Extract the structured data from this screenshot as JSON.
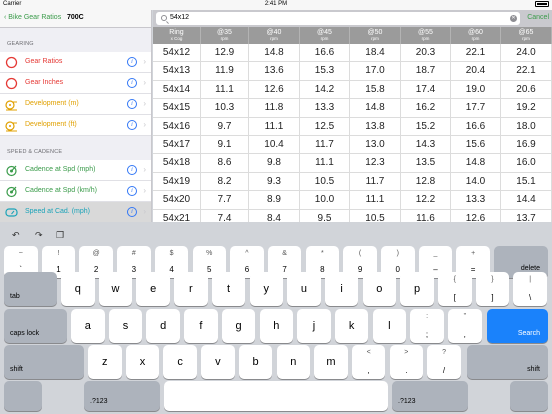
{
  "status": {
    "carrier": "Carrier",
    "time": "2:41 PM"
  },
  "sidebar": {
    "back_label": "Bike Gear Ratios",
    "wheel": "700C",
    "section1": "GEARING",
    "section2": "SPEED & CADENCE",
    "items": [
      {
        "label": "Gear Ratios",
        "color": "#e53935",
        "icon": "ring-icon"
      },
      {
        "label": "Gear Inches",
        "color": "#e53935",
        "icon": "ring-icon"
      },
      {
        "label": "Development (m)",
        "color": "#e0a000",
        "icon": "wheel-arrow-icon"
      },
      {
        "label": "Development (ft)",
        "color": "#e0a000",
        "icon": "wheel-arrow-icon"
      },
      {
        "label": "Cadence at Spd (mph)",
        "color": "#3a9b4a",
        "icon": "pedal-icon"
      },
      {
        "label": "Cadence at Spd (km/h)",
        "color": "#3a9b4a",
        "icon": "pedal-icon"
      },
      {
        "label": "Speed at Cad. (mph)",
        "color": "#1aa3b8",
        "icon": "speedometer-icon"
      }
    ]
  },
  "search": {
    "value": "54x12",
    "cancel": "Cancel"
  },
  "table": {
    "headers": [
      {
        "top": "Ring",
        "sub": "x Cog"
      },
      {
        "top": "@35",
        "sub": "rpm"
      },
      {
        "top": "@40",
        "sub": "rpm"
      },
      {
        "top": "@45",
        "sub": "rpm"
      },
      {
        "top": "@50",
        "sub": "rpm"
      },
      {
        "top": "@55",
        "sub": "rpm"
      },
      {
        "top": "@60",
        "sub": "rpm"
      },
      {
        "top": "@65",
        "sub": "rpm"
      }
    ],
    "rows": [
      [
        "54x12",
        "12.9",
        "14.8",
        "16.6",
        "18.4",
        "20.3",
        "22.1",
        "24.0"
      ],
      [
        "54x13",
        "11.9",
        "13.6",
        "15.3",
        "17.0",
        "18.7",
        "20.4",
        "22.1"
      ],
      [
        "54x14",
        "11.1",
        "12.6",
        "14.2",
        "15.8",
        "17.4",
        "19.0",
        "20.6"
      ],
      [
        "54x15",
        "10.3",
        "11.8",
        "13.3",
        "14.8",
        "16.2",
        "17.7",
        "19.2"
      ],
      [
        "54x16",
        "9.7",
        "11.1",
        "12.5",
        "13.8",
        "15.2",
        "16.6",
        "18.0"
      ],
      [
        "54x17",
        "9.1",
        "10.4",
        "11.7",
        "13.0",
        "14.3",
        "15.6",
        "16.9"
      ],
      [
        "54x18",
        "8.6",
        "9.8",
        "11.1",
        "12.3",
        "13.5",
        "14.8",
        "16.0"
      ],
      [
        "54x19",
        "8.2",
        "9.3",
        "10.5",
        "11.7",
        "12.8",
        "14.0",
        "15.1"
      ],
      [
        "54x20",
        "7.7",
        "8.9",
        "10.0",
        "11.1",
        "12.2",
        "13.3",
        "14.4"
      ],
      [
        "54x21",
        "7.4",
        "8.4",
        "9.5",
        "10.5",
        "11.6",
        "12.6",
        "13.7"
      ]
    ]
  },
  "keyboard": {
    "row1": [
      {
        "top": "~",
        "bot": "`"
      },
      {
        "top": "!",
        "bot": "1"
      },
      {
        "top": "@",
        "bot": "2"
      },
      {
        "top": "#",
        "bot": "3"
      },
      {
        "top": "$",
        "bot": "4"
      },
      {
        "top": "%",
        "bot": "5"
      },
      {
        "top": "^",
        "bot": "6"
      },
      {
        "top": "&",
        "bot": "7"
      },
      {
        "top": "*",
        "bot": "8"
      },
      {
        "top": "(",
        "bot": "9"
      },
      {
        "top": ")",
        "bot": "0"
      },
      {
        "top": "_",
        "bot": "–"
      },
      {
        "top": "+",
        "bot": "="
      }
    ],
    "delete": "delete",
    "tab": "tab",
    "row2": [
      "q",
      "w",
      "e",
      "r",
      "t",
      "y",
      "u",
      "i",
      "o",
      "p"
    ],
    "row2_extra": [
      {
        "top": "{",
        "bot": "["
      },
      {
        "top": "}",
        "bot": "]"
      },
      {
        "top": "|",
        "bot": "\\"
      }
    ],
    "caps": "caps lock",
    "row3": [
      "a",
      "s",
      "d",
      "f",
      "g",
      "h",
      "j",
      "k",
      "l"
    ],
    "row3_extra": [
      {
        "top": ":",
        "bot": ";"
      },
      {
        "top": "”",
        "bot": ","
      }
    ],
    "search": "Search",
    "shift": "shift",
    "row4": [
      "z",
      "x",
      "c",
      "v",
      "b",
      "n",
      "m"
    ],
    "row4_extra": [
      {
        "top": "<",
        "bot": ","
      },
      {
        "top": ">",
        "bot": "."
      },
      {
        "top": "?",
        "bot": "/"
      }
    ],
    "numbers": ".?123"
  }
}
